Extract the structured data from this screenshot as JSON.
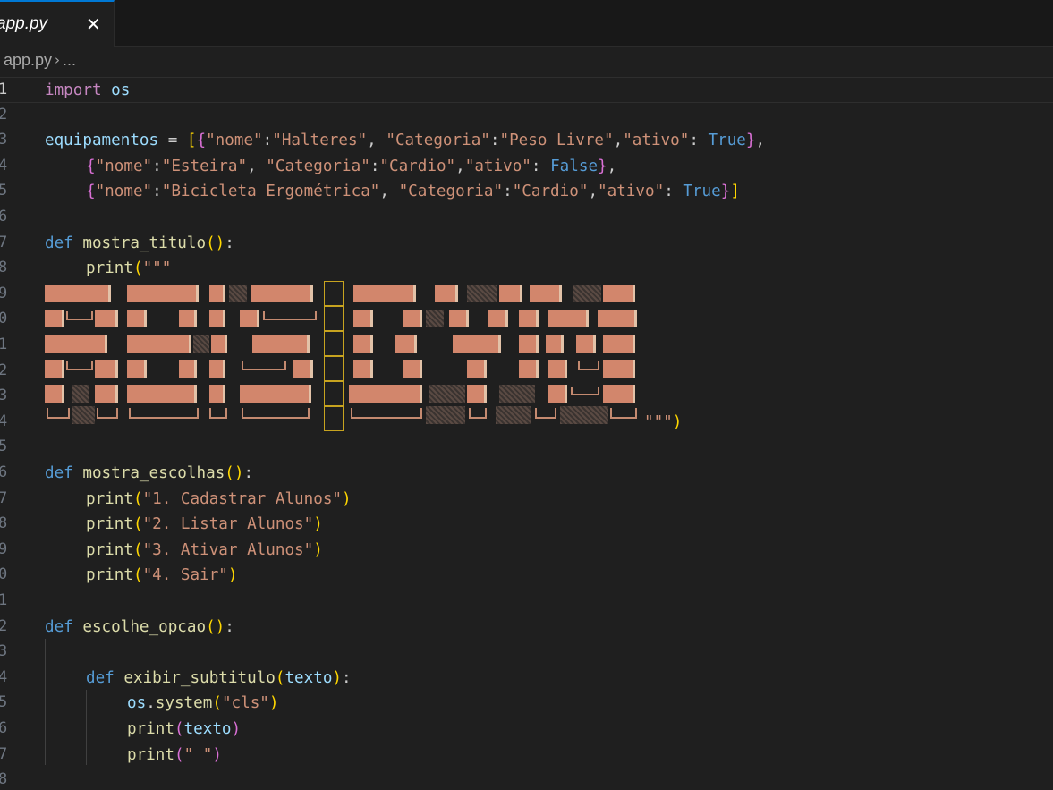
{
  "tab": {
    "label": "app.py",
    "close_glyph": "✕"
  },
  "breadcrumb": {
    "file": "app.py",
    "separator": "›",
    "more": "..."
  },
  "line_numbers": [
    "1",
    "2",
    "3",
    "4",
    "5",
    "6",
    "7",
    "8",
    "9",
    "0",
    "1",
    "2",
    "3",
    "4",
    "5",
    "6",
    "7",
    "8",
    "9",
    "0",
    "1",
    "2",
    "3",
    "4",
    "5",
    "6",
    "7",
    "8"
  ],
  "code": {
    "l1": {
      "kw": "import",
      "mod": "os"
    },
    "l3": {
      "var": "equipamentos",
      "eq": " = ",
      "b_open": "[",
      "c_open": "{",
      "k1": "\"nome\"",
      "c1": ":",
      "v1": "\"Halteres\"",
      "s1": ", ",
      "k2": "\"Categoria\"",
      "c2": ":",
      "v2": "\"Peso Livre\"",
      "s2": ",",
      "k3": "\"ativo\"",
      "c3": ": ",
      "v3": "True",
      "c_close": "}",
      "tail": ","
    },
    "l4": {
      "c_open": "{",
      "k1": "\"nome\"",
      "c1": ":",
      "v1": "\"Esteira\"",
      "s1": ", ",
      "k2": "\"Categoria\"",
      "c2": ":",
      "v2": "\"Cardio\"",
      "s2": ",",
      "k3": "\"ativo\"",
      "c3": ": ",
      "v3": "False",
      "c_close": "}",
      "tail": ","
    },
    "l5": {
      "c_open": "{",
      "k1": "\"nome\"",
      "c1": ":",
      "v1": "\"Bicicleta Ergométrica\"",
      "s1": ", ",
      "k2": "\"Categoria\"",
      "c2": ":",
      "v2": "\"Cardio\"",
      "s2": ",",
      "k3": "\"ativo\"",
      "c3": ": ",
      "v3": "True",
      "c_close": "}",
      "b_close": "]"
    },
    "l7": {
      "def": "def",
      "fn": "mostra_titulo",
      "paren": "()",
      "colon": ":"
    },
    "l8": {
      "fn": "print",
      "paren": "(",
      "str": "\"\"\""
    },
    "l14": {
      "str": "\"\"\"",
      "paren": ")"
    },
    "l16": {
      "def": "def",
      "fn": "mostra_escolhas",
      "paren": "()",
      "colon": ":"
    },
    "l17": {
      "fn": "print",
      "po": "(",
      "str": "\"1. Cadastrar Alunos\"",
      "pc": ")"
    },
    "l18": {
      "fn": "print",
      "po": "(",
      "str": "\"2. Listar Alunos\"",
      "pc": ")"
    },
    "l19": {
      "fn": "print",
      "po": "(",
      "str": "\"3. Ativar Alunos\"",
      "pc": ")"
    },
    "l20": {
      "fn": "print",
      "po": "(",
      "str": "\"4. Sair\"",
      "pc": ")"
    },
    "l22": {
      "def": "def",
      "fn": "escolhe_opcao",
      "paren": "()",
      "colon": ":"
    },
    "l24": {
      "def": "def",
      "fn": "exibir_subtitulo",
      "po": "(",
      "arg": "texto",
      "pc": ")",
      "colon": ":"
    },
    "l25": {
      "mod": "os",
      "dot": ".",
      "fn": "system",
      "po": "(",
      "str": "\"cls\"",
      "pc": ")"
    },
    "l26": {
      "fn": "print",
      "po": "(",
      "arg": "texto",
      "pc": ")"
    },
    "l27": {
      "fn": "print",
      "po": "(",
      "str": "\" \"",
      "pc": ")"
    }
  },
  "colors": {
    "accent": "#0078d4",
    "keyword": "#c586c0",
    "def": "#569cd6",
    "function": "#dcdcaa",
    "variable": "#9cdcfe",
    "string": "#ce9178",
    "bracket_gold": "#ffd700",
    "bracket_pink": "#da70d6",
    "bracket_blue": "#179fff",
    "banner_fill": "#d2866c"
  }
}
